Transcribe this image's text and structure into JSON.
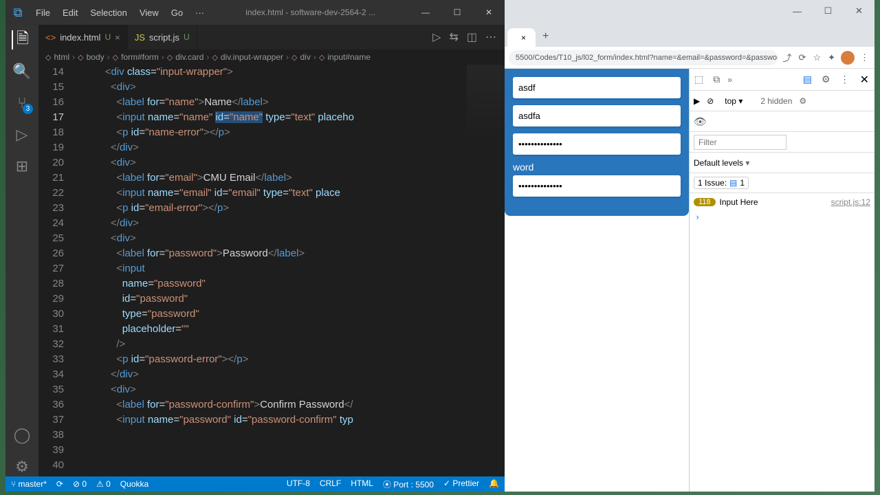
{
  "vscode": {
    "menu": [
      "File",
      "Edit",
      "Selection",
      "View",
      "Go"
    ],
    "menu_more": "···",
    "title": "index.html - software-dev-2564-2 ...",
    "tabs": [
      {
        "icon": "<>",
        "icon_color": "#e37933",
        "label": "index.html",
        "mark": "U",
        "active": true,
        "close": "×"
      },
      {
        "icon": "JS",
        "icon_color": "#cbcb41",
        "label": "script.js",
        "mark": "U",
        "active": false
      }
    ],
    "crumbs": [
      "html",
      "body",
      "form#form",
      "div.card",
      "div.input-wrapper",
      "div",
      "input#name"
    ],
    "scm_badge": "3",
    "lines": [
      {
        "n": "14",
        "ind": 5,
        "html": "<span class='t-br'>&lt;</span><span class='t-tag'>div</span> <span class='t-attr'>class</span>=<span class='t-str'>\"input-wrapper\"</span><span class='t-br'>&gt;</span>"
      },
      {
        "n": "15",
        "ind": 6,
        "html": "<span class='t-br'>&lt;</span><span class='t-tag'>div</span><span class='t-br'>&gt;</span>"
      },
      {
        "n": "16",
        "ind": 7,
        "html": "<span class='t-br'>&lt;</span><span class='t-tag'>label</span> <span class='t-attr'>for</span>=<span class='t-str'>\"name\"</span><span class='t-br'>&gt;</span><span class='t-txt'>Name</span><span class='t-br'>&lt;/</span><span class='t-tag'>label</span><span class='t-br'>&gt;</span>"
      },
      {
        "n": "17",
        "ind": 7,
        "cur": true,
        "html": "<span class='t-br'>&lt;</span><span class='t-tag'>input</span> <span class='t-attr'>name</span>=<span class='t-str'>\"name\"</span> <span class='hl'><span class='t-attr'>id</span>=<span class='t-str'>\"name\"</span></span> <span class='t-attr'>type</span>=<span class='t-str'>\"text\"</span> <span class='t-attr'>placeho</span>"
      },
      {
        "n": "18",
        "ind": 7,
        "html": "<span class='t-br'>&lt;</span><span class='t-tag'>p</span> <span class='t-attr'>id</span>=<span class='t-str'>\"name-error\"</span><span class='t-br'>&gt;&lt;/</span><span class='t-tag'>p</span><span class='t-br'>&gt;</span>"
      },
      {
        "n": "19",
        "ind": 6,
        "html": "<span class='t-br'>&lt;/</span><span class='t-tag'>div</span><span class='t-br'>&gt;</span>"
      },
      {
        "n": "20",
        "ind": 0,
        "html": ""
      },
      {
        "n": "21",
        "ind": 6,
        "html": "<span class='t-br'>&lt;</span><span class='t-tag'>div</span><span class='t-br'>&gt;</span>"
      },
      {
        "n": "22",
        "ind": 7,
        "html": "<span class='t-br'>&lt;</span><span class='t-tag'>label</span> <span class='t-attr'>for</span>=<span class='t-str'>\"email\"</span><span class='t-br'>&gt;</span><span class='t-txt'>CMU Email</span><span class='t-br'>&lt;/</span><span class='t-tag'>label</span><span class='t-br'>&gt;</span>"
      },
      {
        "n": "23",
        "ind": 7,
        "html": "<span class='t-br'>&lt;</span><span class='t-tag'>input</span> <span class='t-attr'>name</span>=<span class='t-str'>\"email\"</span> <span class='t-attr'>id</span>=<span class='t-str'>\"email\"</span> <span class='t-attr'>type</span>=<span class='t-str'>\"text\"</span> <span class='t-attr'>place</span>"
      },
      {
        "n": "24",
        "ind": 7,
        "html": "<span class='t-br'>&lt;</span><span class='t-tag'>p</span> <span class='t-attr'>id</span>=<span class='t-str'>\"email-error\"</span><span class='t-br'>&gt;&lt;/</span><span class='t-tag'>p</span><span class='t-br'>&gt;</span>"
      },
      {
        "n": "25",
        "ind": 6,
        "html": "<span class='t-br'>&lt;/</span><span class='t-tag'>div</span><span class='t-br'>&gt;</span>"
      },
      {
        "n": "26",
        "ind": 0,
        "html": ""
      },
      {
        "n": "27",
        "ind": 6,
        "html": "<span class='t-br'>&lt;</span><span class='t-tag'>div</span><span class='t-br'>&gt;</span>"
      },
      {
        "n": "28",
        "ind": 7,
        "html": "<span class='t-br'>&lt;</span><span class='t-tag'>label</span> <span class='t-attr'>for</span>=<span class='t-str'>\"password\"</span><span class='t-br'>&gt;</span><span class='t-txt'>Password</span><span class='t-br'>&lt;/</span><span class='t-tag'>label</span><span class='t-br'>&gt;</span>"
      },
      {
        "n": "29",
        "ind": 7,
        "html": "<span class='t-br'>&lt;</span><span class='t-tag'>input</span>"
      },
      {
        "n": "30",
        "ind": 8,
        "html": "<span class='t-attr'>name</span>=<span class='t-str'>\"password\"</span>"
      },
      {
        "n": "31",
        "ind": 8,
        "html": "<span class='t-attr'>id</span>=<span class='t-str'>\"password\"</span>"
      },
      {
        "n": "32",
        "ind": 8,
        "html": "<span class='t-attr'>type</span>=<span class='t-str'>\"password\"</span>"
      },
      {
        "n": "33",
        "ind": 8,
        "html": "<span class='t-attr'>placeholder</span>=<span class='t-str'>\"\"</span>"
      },
      {
        "n": "34",
        "ind": 7,
        "html": "<span class='t-br'>/&gt;</span>"
      },
      {
        "n": "35",
        "ind": 7,
        "html": "<span class='t-br'>&lt;</span><span class='t-tag'>p</span> <span class='t-attr'>id</span>=<span class='t-str'>\"password-error\"</span><span class='t-br'>&gt;&lt;/</span><span class='t-tag'>p</span><span class='t-br'>&gt;</span>"
      },
      {
        "n": "36",
        "ind": 6,
        "html": "<span class='t-br'>&lt;/</span><span class='t-tag'>div</span><span class='t-br'>&gt;</span>"
      },
      {
        "n": "37",
        "ind": 0,
        "html": ""
      },
      {
        "n": "38",
        "ind": 6,
        "html": "<span class='t-br'>&lt;</span><span class='t-tag'>div</span><span class='t-br'>&gt;</span>"
      },
      {
        "n": "39",
        "ind": 7,
        "html": "<span class='t-br'>&lt;</span><span class='t-tag'>label</span> <span class='t-attr'>for</span>=<span class='t-str'>\"password-confirm\"</span><span class='t-br'>&gt;</span><span class='t-txt'>Confirm Password</span><span class='t-br'>&lt;/</span>"
      },
      {
        "n": "40",
        "ind": 7,
        "html": "<span class='t-br'>&lt;</span><span class='t-tag'>input</span> <span class='t-attr'>name</span>=<span class='t-str'>\"password\"</span> <span class='t-attr'>id</span>=<span class='t-str'>\"password-confirm\"</span> <span class='t-attr'>typ</span>"
      }
    ],
    "status": {
      "branch": "master*",
      "sync": "⟳",
      "errors": "⊘ 0",
      "warnings": "⚠ 0",
      "quokka": "Quokka",
      "encoding": "UTF-8",
      "eol": "CRLF",
      "lang": "HTML",
      "port": "⦿ Port : 5500",
      "prettier": "✓ Prettier",
      "bell": "🔔"
    }
  },
  "browser": {
    "url": "5500/Codes/T10_js/l02_form/index.html?name=&email=&password=&password=",
    "tab": "",
    "form": {
      "name_val": "asdf",
      "email_val": "asdfa",
      "pw_val": "••••••••••••••",
      "pw2_label": "word",
      "pw2_val": "••••••••••••••"
    },
    "devtools": {
      "context": "top ▾",
      "hidden": "2 hidden",
      "filter_ph": "Filter",
      "levels": "Default levels",
      "issue": "1 Issue:",
      "issue_n": "1",
      "log_count": "118",
      "log_msg": "Input Here",
      "log_src": "script.js:12",
      "prompt": "›"
    }
  }
}
